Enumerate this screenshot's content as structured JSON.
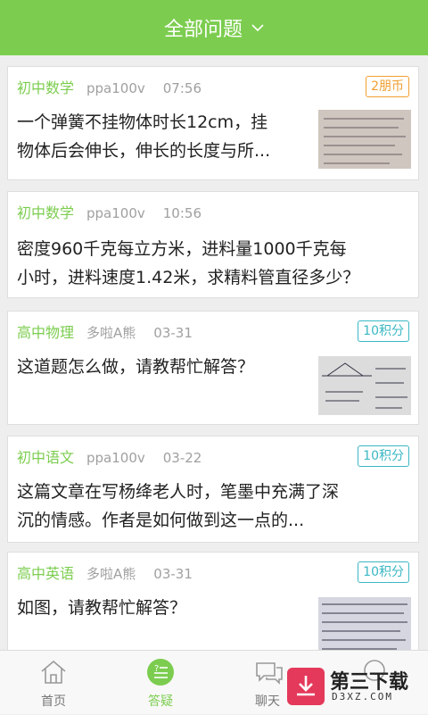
{
  "header": {
    "title": "全部问题"
  },
  "questions": [
    {
      "subject": "初中数学",
      "user": "ppa100v",
      "time": "07:56",
      "badge": "2朋币",
      "title_line1": "一个弹簧不挂物体时长12cm，挂",
      "title_line2": "物体后会伸长，伸长的长度与所..."
    },
    {
      "subject": "初中数学",
      "user": "ppa100v",
      "time": "10:56",
      "badge": "",
      "title_line1": "密度960千克每立方米，进料量1000千克每",
      "title_line2": "小时，进料速度1.42米，求精料管直径多少？"
    },
    {
      "subject": "高中物理",
      "user": "多啦A熊",
      "time": "03-31",
      "badge": "10积分",
      "title_line1": "这道题怎么做，请教帮忙解答？",
      "title_line2": ""
    },
    {
      "subject": "初中语文",
      "user": "ppa100v",
      "time": "03-22",
      "badge": "10积分",
      "title_line1": "这篇文章在写杨绛老人时，笔墨中充满了深",
      "title_line2": "沉的情感。作者是如何做到这一点的..."
    },
    {
      "subject": "高中英语",
      "user": "多啦A熊",
      "time": "03-31",
      "badge": "10积分",
      "title_line1": "如图，请教帮忙解答？",
      "title_line2": ""
    }
  ],
  "tabs": [
    {
      "label": "首页",
      "icon": "home-icon"
    },
    {
      "label": "答疑",
      "icon": "qa-icon"
    },
    {
      "label": "聊天",
      "icon": "chat-icon"
    },
    {
      "label": "",
      "icon": "more-icon"
    }
  ],
  "watermark": {
    "name": "第三下载",
    "domain": "D3XZ.COM"
  },
  "colors": {
    "accent": "#7ccd4f",
    "badge_orange": "#f0a030",
    "badge_teal": "#3ab7c4"
  }
}
